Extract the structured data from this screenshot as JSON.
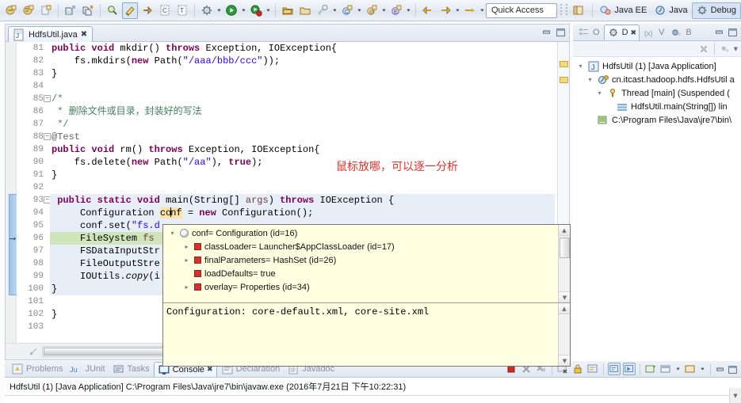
{
  "toolbar": {
    "quick_access": "Quick Access",
    "groups": [
      {
        "buttons": [
          {
            "name": "new-java-project-icon",
            "glyph": "newproj"
          },
          {
            "name": "new-package-icon",
            "glyph": "newpkg"
          },
          {
            "name": "new-wizard-icon",
            "glyph": "newwiz"
          }
        ]
      },
      {
        "buttons": [
          {
            "name": "save-icon",
            "glyph": "save"
          },
          {
            "name": "save-all-icon",
            "glyph": "saveall"
          }
        ]
      },
      {
        "buttons": [
          {
            "name": "search-icon",
            "glyph": "search"
          },
          {
            "name": "highlight-pen-icon",
            "glyph": "pen",
            "pressed": true
          },
          {
            "name": "next-annotation-icon",
            "glyph": "nextann"
          },
          {
            "name": "open-type-icon",
            "glyph": "opentype"
          },
          {
            "name": "open-task-icon",
            "glyph": "opentask"
          }
        ]
      },
      {
        "buttons": [
          {
            "name": "debug-icon",
            "glyph": "debug",
            "menu": true
          },
          {
            "name": "run-icon",
            "glyph": "run",
            "menu": true
          },
          {
            "name": "run-external-tools-icon",
            "glyph": "exttool",
            "menu": true
          }
        ]
      },
      {
        "buttons": [
          {
            "name": "open-folder-icon",
            "glyph": "folder1"
          },
          {
            "name": "open-folder-alt-icon",
            "glyph": "folder2"
          },
          {
            "name": "run-last-tool-icon",
            "glyph": "wrench",
            "menu": true
          },
          {
            "name": "new-java-class-icon",
            "glyph": "newclass",
            "menu": true
          },
          {
            "name": "new-annotation-icon",
            "glyph": "newannot",
            "menu": true
          },
          {
            "name": "new-enum-icon",
            "glyph": "newenum",
            "menu": true
          }
        ]
      },
      {
        "buttons": [
          {
            "name": "back-icon",
            "glyph": "back"
          },
          {
            "name": "forward-icon",
            "glyph": "fwd",
            "menu": true
          },
          {
            "name": "next-edit-icon",
            "glyph": "nextedit",
            "menu": true
          }
        ]
      }
    ],
    "perspectives": [
      {
        "name": "open-perspective-button",
        "label": "",
        "icon": "open-perspective-icon",
        "active": false
      },
      {
        "name": "perspective-java-ee",
        "label": "Java EE",
        "icon": "java-ee-icon",
        "active": false
      },
      {
        "name": "perspective-java",
        "label": "Java",
        "icon": "java-icon",
        "active": false
      },
      {
        "name": "perspective-debug",
        "label": "Debug",
        "icon": "debug-perspective-icon",
        "active": true
      }
    ]
  },
  "editor": {
    "tab_label": "HdfsUtil.java",
    "tab_close": "✖",
    "minimize_title": "Minimize",
    "maximize_title": "Maximize",
    "first_line": 81,
    "lines": [
      {
        "n": 81,
        "fold": false,
        "state": "",
        "html": "<span class=\"kw\">public</span> <span class=\"kw\">void</span> mkdir() <span class=\"kw\">throws</span> Exception, IOException{"
      },
      {
        "n": 82,
        "fold": false,
        "state": "",
        "html": "    fs.mkdirs(<span class=\"kw\">new</span> Path(<span class=\"str\">\"/aaa/bbb/ccc\"</span>));"
      },
      {
        "n": 83,
        "fold": false,
        "state": "",
        "html": "}"
      },
      {
        "n": 84,
        "fold": false,
        "state": "",
        "html": ""
      },
      {
        "n": 85,
        "fold": true,
        "state": "",
        "html": "<span class=\"cmt\">/*</span>"
      },
      {
        "n": 86,
        "fold": false,
        "state": "",
        "html": " <span class=\"cmt\">* 删除文件或目录，封装好的写法</span>"
      },
      {
        "n": 87,
        "fold": false,
        "state": "",
        "html": " <span class=\"cmt\">*/</span>"
      },
      {
        "n": 88,
        "fold": true,
        "state": "",
        "html": "<span class=\"ann\">@Test</span>"
      },
      {
        "n": 89,
        "fold": false,
        "state": "",
        "html": "<span class=\"kw\">public</span> <span class=\"kw\">void</span> rm() <span class=\"kw\">throws</span> Exception, IOException{"
      },
      {
        "n": 90,
        "fold": false,
        "state": "",
        "html": "    fs.delete(<span class=\"kw\">new</span> Path(<span class=\"str\">\"/aa\"</span>), <span class=\"kw\">true</span>);"
      },
      {
        "n": 91,
        "fold": false,
        "state": "",
        "html": "}"
      },
      {
        "n": 92,
        "fold": false,
        "state": "",
        "html": ""
      },
      {
        "n": 93,
        "fold": true,
        "state": "sel",
        "html": " <span class=\"kw\">public</span> <span class=\"kw\">static</span> <span class=\"kw\">void</span> main(String[] <span class=\"lvar\">args</span>) <span class=\"kw\">throws</span> IOException {"
      },
      {
        "n": 94,
        "fold": false,
        "state": "sel",
        "html": "     Configuration <span class=\"occ\">co<span class=\"caret\"></span>nf</span> = <span class=\"kw\">new</span> Configuration();"
      },
      {
        "n": 95,
        "fold": false,
        "state": "sel",
        "html": "     conf.set(<span class=\"str\">\"fs.d</span>"
      },
      {
        "n": 96,
        "fold": false,
        "state": "exec",
        "html": "     FileSystem <span class=\"lvar\">fs</span>"
      },
      {
        "n": 97,
        "fold": false,
        "state": "sel",
        "html": "     FSDataInputStr"
      },
      {
        "n": 98,
        "fold": false,
        "state": "sel",
        "html": "     FileOutputStre"
      },
      {
        "n": 99,
        "fold": false,
        "state": "sel",
        "html": "     IOUtils.<span class=\"ital\">copy</span>(i"
      },
      {
        "n": 100,
        "fold": false,
        "state": "sel",
        "html": "}"
      },
      {
        "n": 101,
        "fold": false,
        "state": "",
        "html": ""
      },
      {
        "n": 102,
        "fold": false,
        "state": "",
        "html": "}"
      },
      {
        "n": 103,
        "fold": false,
        "state": "",
        "html": ""
      }
    ],
    "frame_bar_from": 93,
    "frame_bar_to": 100,
    "debug_arrow_line": 96
  },
  "annotation": {
    "text": "鼠标放哪，可以逐一分析",
    "color": "#e8302a"
  },
  "variable_popup": {
    "rows": [
      {
        "indent": 0,
        "twisty": "open",
        "icon": "object",
        "label": "conf= Configuration  (id=16)"
      },
      {
        "indent": 1,
        "twisty": "closed",
        "icon": "field",
        "label": "classLoader= Launcher$AppClassLoader  (id=17)"
      },
      {
        "indent": 1,
        "twisty": "closed",
        "icon": "field",
        "label": "finalParameters= HashSet<E>  (id=26)"
      },
      {
        "indent": 1,
        "twisty": "none",
        "icon": "field",
        "label": "loadDefaults= true"
      },
      {
        "indent": 1,
        "twisty": "closed",
        "icon": "field",
        "label": "overlay= Properties  (id=34)"
      }
    ],
    "detail": "Configuration: core-default.xml, core-site.xml",
    "scroll_up": "▲",
    "scroll_down": "▼"
  },
  "debug_view": {
    "tabs": [
      {
        "name": "tab-outline",
        "label": "O",
        "icon": "outline-icon",
        "active": false
      },
      {
        "name": "tab-debug",
        "label": "D",
        "icon": "debug-view-icon",
        "active": true,
        "close": "✖"
      },
      {
        "name": "tab-variables",
        "label": "V",
        "icon": "variables-icon",
        "active": false
      },
      {
        "name": "tab-breakpoints",
        "label": "B",
        "icon": "breakpoints-icon",
        "active": false
      }
    ],
    "minimize_title": "Minimize",
    "maximize_title": "Maximize",
    "tools": [
      {
        "name": "disconnect-icon"
      },
      {
        "name": "view-menu-icon"
      }
    ],
    "tree": [
      {
        "indent": 0,
        "twisty": "open",
        "icon": "launch-icon",
        "label": "HdfsUtil (1) [Java Application]"
      },
      {
        "indent": 1,
        "twisty": "open",
        "icon": "vm-icon",
        "label": "cn.itcast.hadoop.hdfs.HdfsUtil a"
      },
      {
        "indent": 2,
        "twisty": "open",
        "icon": "thread-icon",
        "label": "Thread [main] (Suspended ("
      },
      {
        "indent": 3,
        "twisty": "none",
        "icon": "frame-icon",
        "label": "HdfsUtil.main(String[]) lin"
      },
      {
        "indent": 1,
        "twisty": "none",
        "icon": "process-icon",
        "label": "C:\\Program Files\\Java\\jre7\\bin\\"
      }
    ]
  },
  "console": {
    "tabs": [
      {
        "name": "tab-problems",
        "label": "Problems",
        "icon": "problems-icon",
        "active": false
      },
      {
        "name": "tab-junit",
        "label": "JUnit",
        "icon": "junit-icon",
        "active": false
      },
      {
        "name": "tab-tasks",
        "label": "Tasks",
        "icon": "tasks-icon",
        "active": false
      },
      {
        "name": "tab-console",
        "label": "Console",
        "icon": "console-icon",
        "active": true,
        "close": "✖"
      },
      {
        "name": "tab-declaration",
        "label": "Declaration",
        "icon": "declaration-icon",
        "active": false
      },
      {
        "name": "tab-javadoc",
        "label": "Javadoc",
        "icon": "javadoc-icon",
        "active": false
      }
    ],
    "tools": [
      {
        "name": "terminate-icon",
        "boxed": false
      },
      {
        "name": "remove-launch-icon",
        "boxed": false
      },
      {
        "name": "remove-all-terminated-icon",
        "boxed": false
      },
      {
        "name": "clear-console-icon",
        "boxed": false
      },
      {
        "name": "scroll-lock-icon",
        "boxed": false
      },
      {
        "name": "show-console-on-output-icon",
        "boxed": false
      },
      {
        "name": "pin-console-icon",
        "boxed": true
      },
      {
        "name": "display-selected-console-icon",
        "boxed": true
      },
      {
        "name": "open-console-icon",
        "boxed": false
      },
      {
        "name": "new-console-view-icon",
        "boxed": false
      },
      {
        "name": "console-menu-icon",
        "boxed": false
      }
    ],
    "status_line": "HdfsUtil (1) [Java Application] C:\\Program Files\\Java\\jre7\\bin\\javaw.exe (2016年7月21日 下午10:22:31)"
  }
}
